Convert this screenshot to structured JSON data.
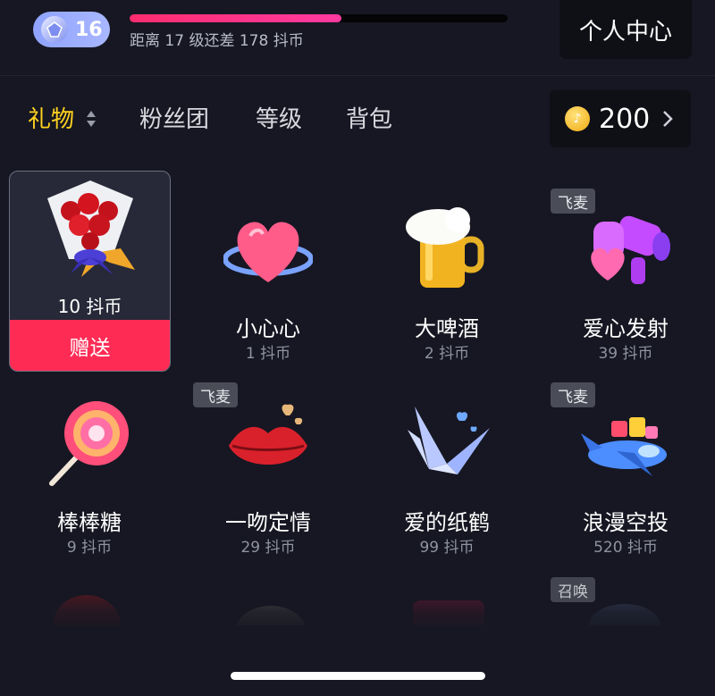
{
  "header": {
    "level": "16",
    "progress_fraction": 0.56,
    "progress_text": "距离 17 级还差 178 抖币",
    "profile_label": "个人中心"
  },
  "tabs": [
    {
      "label": "礼物",
      "active": true
    },
    {
      "label": "粉丝团",
      "active": false
    },
    {
      "label": "等级",
      "active": false
    },
    {
      "label": "背包",
      "active": false
    }
  ],
  "balance": {
    "amount": "200",
    "icon": "coin-icon"
  },
  "selected_gift": {
    "price": "10 抖币",
    "send_label": "赠送",
    "icon": "rose-bouquet-icon"
  },
  "gifts": [
    {
      "name": "小心心",
      "price": "1 抖币",
      "tag": "",
      "icon": "heart-icon"
    },
    {
      "name": "大啤酒",
      "price": "2 抖币",
      "tag": "",
      "icon": "beer-icon"
    },
    {
      "name": "爱心发射",
      "price": "39 抖币",
      "tag": "飞麦",
      "icon": "heart-launcher-icon"
    },
    {
      "name": "棒棒糖",
      "price": "9 抖币",
      "tag": "",
      "icon": "lollipop-icon"
    },
    {
      "name": "一吻定情",
      "price": "29 抖币",
      "tag": "飞麦",
      "icon": "lips-icon"
    },
    {
      "name": "爱的纸鹤",
      "price": "99 抖币",
      "tag": "",
      "icon": "paper-crane-icon"
    },
    {
      "name": "浪漫空投",
      "price": "520 抖币",
      "tag": "飞麦",
      "icon": "airdrop-plane-icon"
    }
  ],
  "next_row_tag": "召唤",
  "colors": {
    "background": "#161722",
    "accent_pink": "#fe2c55",
    "active_tab": "#ffd21f",
    "muted_text": "#8f93a1"
  }
}
